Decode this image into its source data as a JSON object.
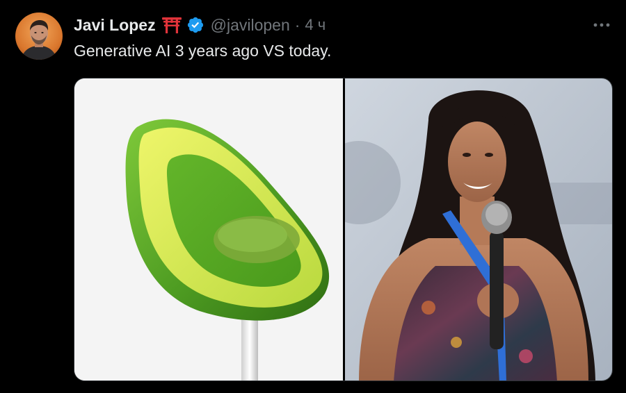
{
  "author": {
    "display_name": "Javi Lopez",
    "handle": "@javilopen",
    "separator": "·",
    "time": "4 ч",
    "name_emoji": "torii-gate-icon",
    "verified": true,
    "verified_color": "#1d9bf0"
  },
  "tweet": {
    "text": "Generative AI 3 years ago VS today."
  },
  "media": {
    "items": [
      {
        "description_icon": "avocado-chair-image"
      },
      {
        "description_icon": "woman-with-microphone-image"
      }
    ]
  },
  "colors": {
    "background": "#000000",
    "text_primary": "#e7e9ea",
    "text_secondary": "#71767b",
    "border": "#2f3336",
    "torii_red": "#e0333a"
  }
}
